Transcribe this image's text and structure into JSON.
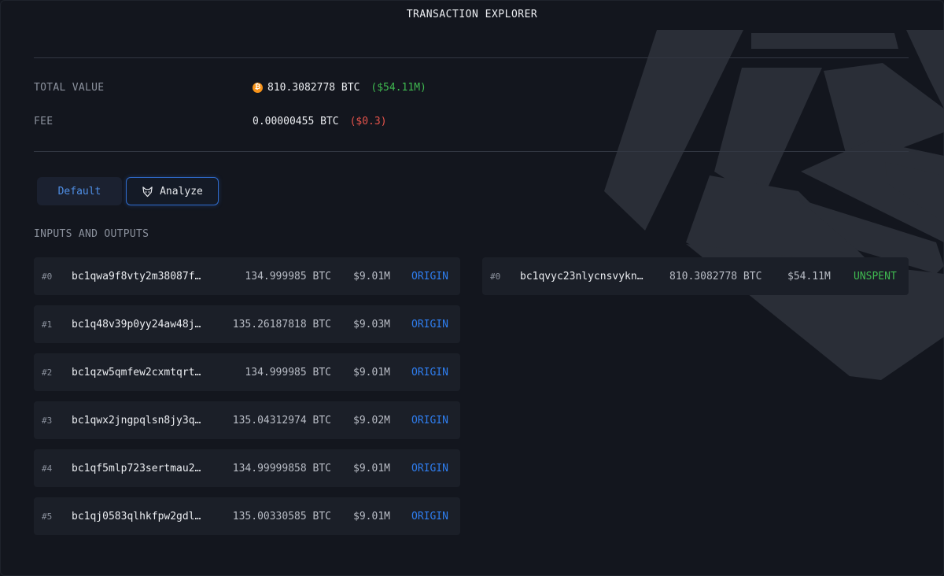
{
  "header": {
    "title": "TRANSACTION EXPLORER"
  },
  "summary": {
    "total_label": "TOTAL VALUE",
    "total_btc": "810.3082778 BTC",
    "total_usd": "($54.11M)",
    "fee_label": "FEE",
    "fee_btc": "0.00000455 BTC",
    "fee_usd": "($0.3)"
  },
  "tabs": {
    "default_label": "Default",
    "analyze_label": "Analyze"
  },
  "section": {
    "label": "INPUTS AND OUTPUTS"
  },
  "inputs": [
    {
      "index": "#0",
      "address": "bc1qwa9f8vty2m38087f…",
      "amount": "134.999985 BTC",
      "usd": "$9.01M",
      "status": "ORIGIN"
    },
    {
      "index": "#1",
      "address": "bc1q48v39p0yy24aw48j…",
      "amount": "135.26187818 BTC",
      "usd": "$9.03M",
      "status": "ORIGIN"
    },
    {
      "index": "#2",
      "address": "bc1qzw5qmfew2cxmtqrt…",
      "amount": "134.999985 BTC",
      "usd": "$9.01M",
      "status": "ORIGIN"
    },
    {
      "index": "#3",
      "address": "bc1qwx2jngpqlsn8jy3q…",
      "amount": "135.04312974 BTC",
      "usd": "$9.02M",
      "status": "ORIGIN"
    },
    {
      "index": "#4",
      "address": "bc1qf5mlp723sertmau2…",
      "amount": "134.99999858 BTC",
      "usd": "$9.01M",
      "status": "ORIGIN"
    },
    {
      "index": "#5",
      "address": "bc1qj0583qlhkfpw2gdl…",
      "amount": "135.00330585 BTC",
      "usd": "$9.01M",
      "status": "ORIGIN"
    }
  ],
  "outputs": [
    {
      "index": "#0",
      "address": "bc1qvyc23nlycnsvykn…",
      "amount": "810.3082778 BTC",
      "usd": "$54.11M",
      "status": "UNSPENT"
    }
  ],
  "icons": {
    "coin": "bitcoin-icon",
    "analyze": "fox-icon"
  },
  "colors": {
    "accent_blue": "#2f7ef0",
    "positive": "#3fb950",
    "negative": "#e5534b",
    "bitcoin": "#f7931a"
  }
}
